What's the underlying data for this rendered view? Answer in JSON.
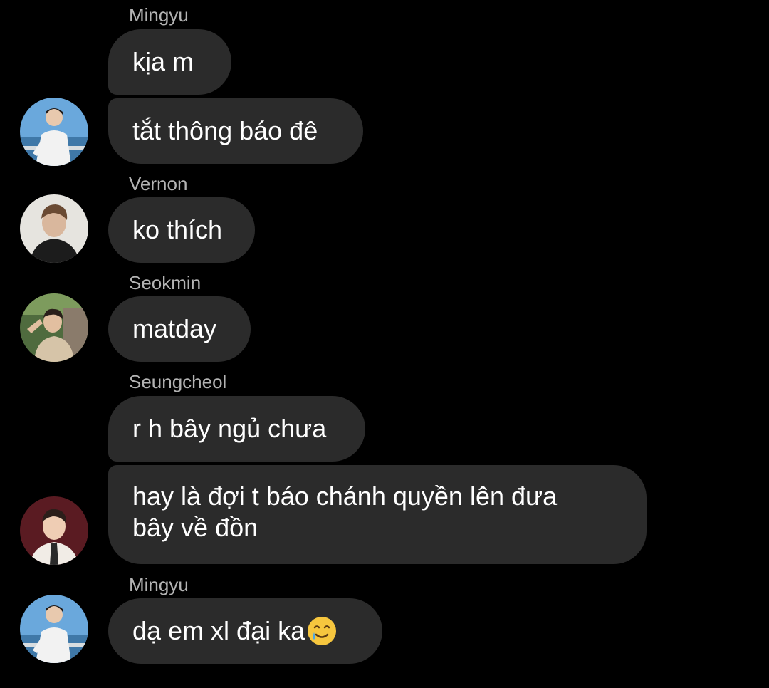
{
  "messages": [
    {
      "sender": "Mingyu",
      "text": "kịa m"
    },
    {
      "sender": "",
      "text": "tắt thông báo đê"
    },
    {
      "sender": "Vernon",
      "text": "ko thích"
    },
    {
      "sender": "Seokmin",
      "text": "matday"
    },
    {
      "sender": "Seungcheol",
      "text": "r h bây ngủ chưa"
    },
    {
      "sender": "",
      "text": "hay là đợi t báo chánh quyền lên đưa bây về đồn"
    },
    {
      "sender": "Mingyu",
      "text": "dạ em xl đại ka",
      "emoji": "smiling-face-with-tear"
    }
  ],
  "avatars": {
    "mingyu": "avatar-mingyu",
    "vernon": "avatar-vernon",
    "seokmin": "avatar-seokmin",
    "seungcheol": "avatar-seungcheol"
  },
  "colors": {
    "background": "#000000",
    "bubble": "#2b2b2b",
    "sender_name": "#b3b3b3",
    "message_text": "#ffffff"
  }
}
